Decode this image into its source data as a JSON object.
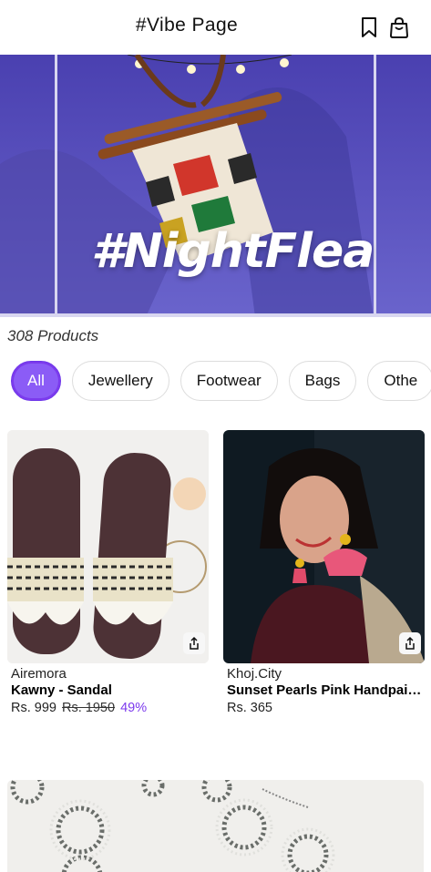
{
  "header": {
    "title": "#Vibe Page",
    "icons": [
      "bookmark-icon",
      "shopping-bag-icon"
    ]
  },
  "banner": {
    "text": "#NightFlea"
  },
  "products_count": "308 Products",
  "categories": [
    {
      "label": "All",
      "active": true
    },
    {
      "label": "Jewellery",
      "active": false
    },
    {
      "label": "Footwear",
      "active": false
    },
    {
      "label": "Bags",
      "active": false
    },
    {
      "label": "Othe",
      "active": false
    }
  ],
  "products": [
    {
      "brand": "Airemora",
      "name": "Kawny - Sandal",
      "price": "Rs. 999",
      "mrp": "Rs. 1950",
      "discount": "49%"
    },
    {
      "brand": "Khoj.City",
      "name": "Sunset Pearls Pink Handpainted Earrings",
      "price": "Rs. 365"
    }
  ],
  "colors": {
    "accent": "#8b5cf6",
    "discount": "#7c3aed",
    "banner_bg": "#5a54c0"
  }
}
